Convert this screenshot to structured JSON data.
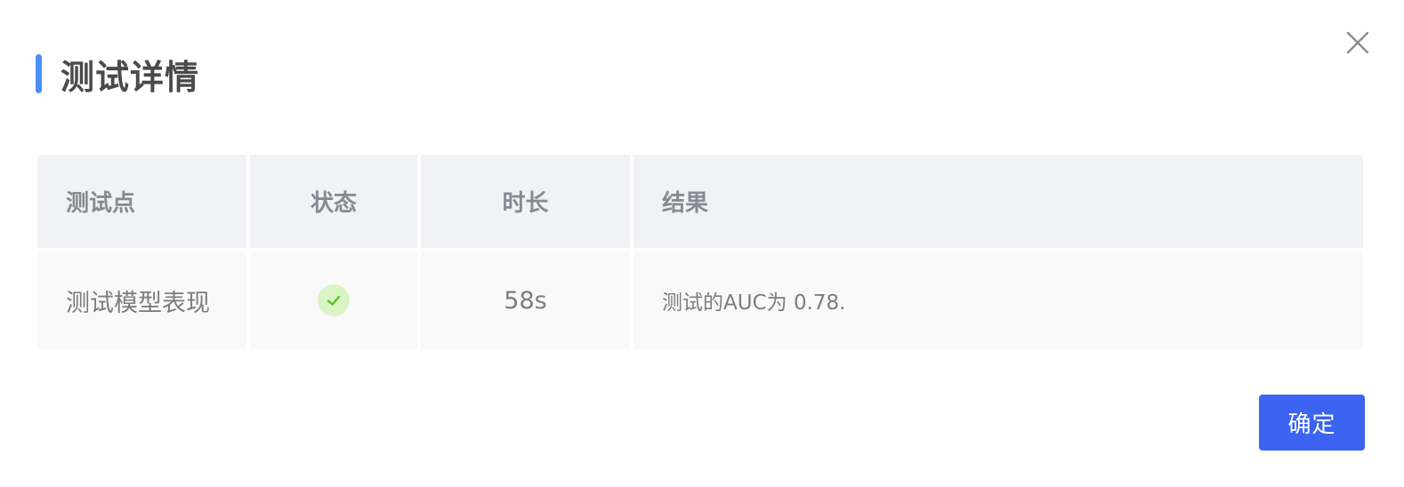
{
  "dialog": {
    "title": "测试详情",
    "close_icon": "close-icon",
    "accent_color": "#4a90f7"
  },
  "table": {
    "columns": [
      "测试点",
      "状态",
      "时长",
      "结果"
    ],
    "rows": [
      {
        "test_point": "测试模型表现",
        "status_icon": "check-circle-icon",
        "status_color": "#52c41a",
        "duration": "58s",
        "result": "测试的AUC为 0.78."
      }
    ]
  },
  "footer": {
    "confirm_label": "确定",
    "confirm_color": "#3c63f2"
  }
}
